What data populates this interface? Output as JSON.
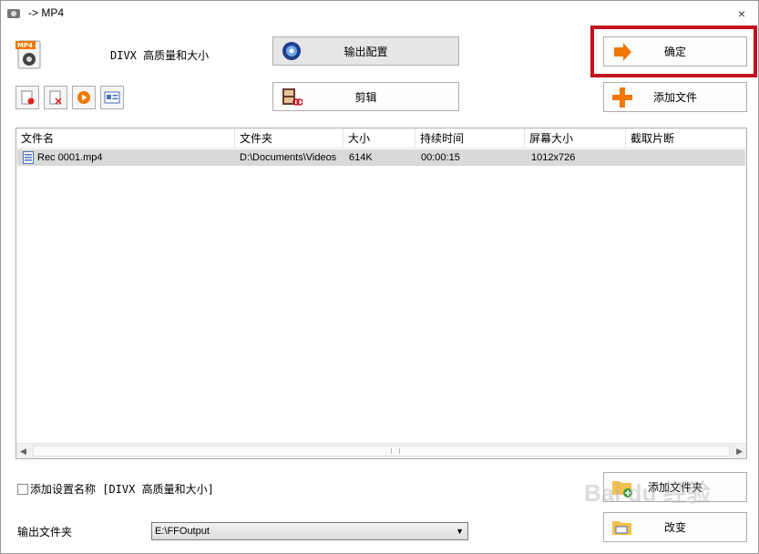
{
  "window": {
    "title": "-> MP4",
    "close_label": "×"
  },
  "format": {
    "label": "DIVX 高质量和大小",
    "icon": "mp4-file-icon"
  },
  "buttons": {
    "output_settings": "输出配置",
    "edit": "剪辑",
    "ok": "确定",
    "add_file": "添加文件",
    "add_folder": "添加文件夹",
    "change": "改变"
  },
  "toolbar": [
    {
      "name": "remove-icon"
    },
    {
      "name": "clear-icon"
    },
    {
      "name": "play-icon"
    },
    {
      "name": "info-icon"
    }
  ],
  "table": {
    "columns": [
      "文件名",
      "文件夹",
      "大小",
      "持续时间",
      "屏幕大小",
      "截取片断"
    ],
    "rows": [
      {
        "name": "Rec 0001.mp4",
        "folder": "D:\\Documents\\Videos",
        "size": "614K",
        "duration": "00:00:15",
        "screen": "1012x726",
        "clip": ""
      }
    ]
  },
  "add_setting_name": "添加设置名称 [DIVX 高质量和大小]",
  "output_folder": {
    "label": "输出文件夹",
    "value": "E:\\FFOutput"
  },
  "watermark": "Bai du 经验",
  "colors": {
    "highlight": "#c1121f",
    "orange": "#f07800"
  }
}
